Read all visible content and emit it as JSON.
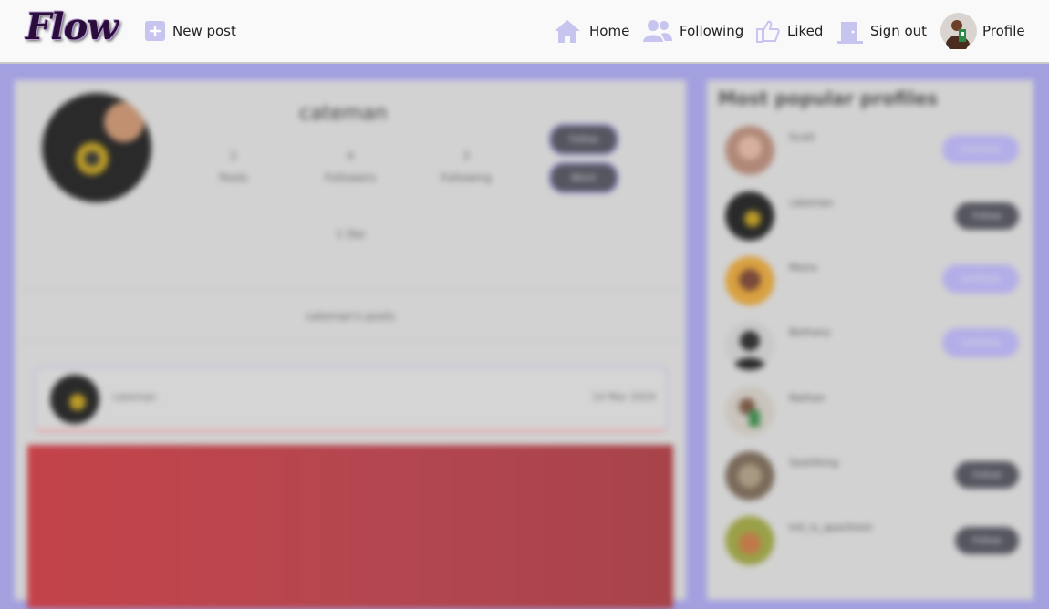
{
  "nav": {
    "logo": "Flow",
    "new_post": "New post",
    "home": "Home",
    "following": "Following",
    "liked": "Liked",
    "sign_out": "Sign out",
    "profile": "Profile"
  },
  "profile": {
    "username": "cateman",
    "stats": [
      {
        "value": "2",
        "label": "Posts"
      },
      {
        "value": "4",
        "label": "Followers"
      },
      {
        "value": "3",
        "label": "Following"
      }
    ],
    "buttons": [
      "Follow",
      "Block"
    ],
    "likes": "1 like",
    "posts_header": "cateman's posts"
  },
  "post": {
    "author": "cateman",
    "date": "14 Mar 2024"
  },
  "sidebar": {
    "title": "Most popular profiles",
    "profiles": [
      {
        "name": "Scott",
        "button": "Unfollow"
      },
      {
        "name": "cateman",
        "button": "Follow"
      },
      {
        "name": "Moira",
        "button": "Unfollow"
      },
      {
        "name": "Bethany",
        "button": "Unfollow"
      },
      {
        "name": "Nathan",
        "button": ""
      },
      {
        "name": "SeaViking",
        "button": "Follow"
      },
      {
        "name": "Inti_is_apartheid",
        "button": "Follow"
      }
    ]
  },
  "colors": {
    "accent": "#a3a0e0",
    "panel": "#d2d2d2",
    "dark_button": "#565660",
    "light_button": "#b3aee8",
    "post_image": "#b8484e"
  }
}
